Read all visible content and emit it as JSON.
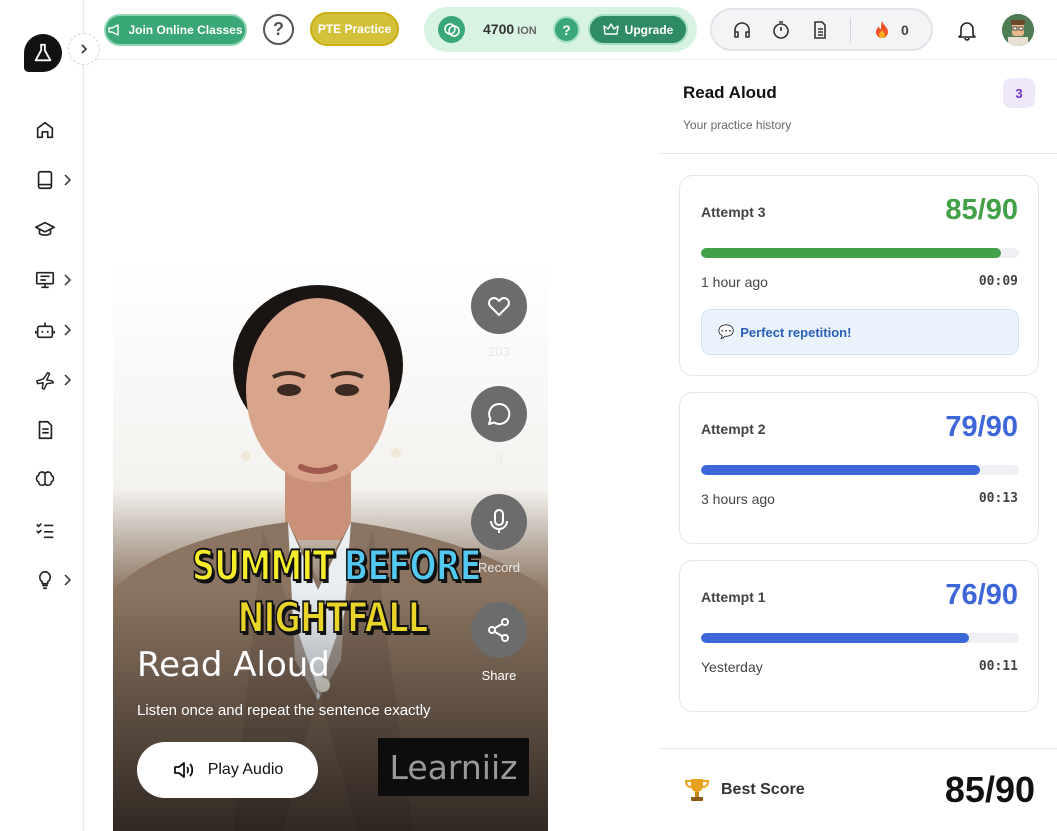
{
  "topbar": {
    "join_label": "Join Online Classes",
    "help_glyph": "?",
    "pte_label": "PTE Practice",
    "ion_amount": "4700",
    "ion_unit": "ION",
    "ion_help_glyph": "?",
    "upgrade_label": "Upgrade",
    "streak_count": "0",
    "colors": {
      "join": "#3aa876",
      "pte": "#d4c13a",
      "ion_bg": "#d9f3e3",
      "upgrade": "#2e8b63"
    }
  },
  "sidebar": {
    "items": [
      {
        "icon": "home-icon"
      },
      {
        "icon": "book-icon",
        "expandable": true
      },
      {
        "icon": "graduation-cap-icon"
      },
      {
        "icon": "presentation-icon",
        "expandable": true
      },
      {
        "icon": "robot-icon",
        "expandable": true
      },
      {
        "icon": "plane-icon",
        "expandable": true
      },
      {
        "icon": "document-icon"
      },
      {
        "icon": "brain-icon"
      },
      {
        "icon": "checklist-icon"
      },
      {
        "icon": "lightbulb-icon",
        "expandable": true
      }
    ]
  },
  "hero": {
    "caption_line1_word1": "SUMMIT",
    "caption_line1_word2": "BEFORE",
    "caption_line2": "NIGHTFALL",
    "title": "Read Aloud",
    "subtitle": "Listen once and repeat the sentence exactly",
    "play_label": "Play Audio",
    "watermark": "Learniiz",
    "actions": {
      "likes": "203",
      "comments": "3",
      "record_label": "Record",
      "share_label": "Share"
    }
  },
  "panel": {
    "title": "Read Aloud",
    "subtitle": "Your practice history",
    "count": "3",
    "attempts": [
      {
        "label": "Attempt 3",
        "score": "85/90",
        "progress": 0.944,
        "time": "1 hour ago",
        "duration": "00:09",
        "feedback": "Perfect repetition!",
        "color": "#41a048"
      },
      {
        "label": "Attempt 2",
        "score": "79/90",
        "progress": 0.878,
        "time": "3 hours ago",
        "duration": "00:13",
        "color": "#3d67d8"
      },
      {
        "label": "Attempt 1",
        "score": "76/90",
        "progress": 0.844,
        "time": "Yesterday",
        "duration": "00:11",
        "color": "#3d67d8"
      }
    ],
    "best_label": "Best Score",
    "best_score": "85/90"
  }
}
